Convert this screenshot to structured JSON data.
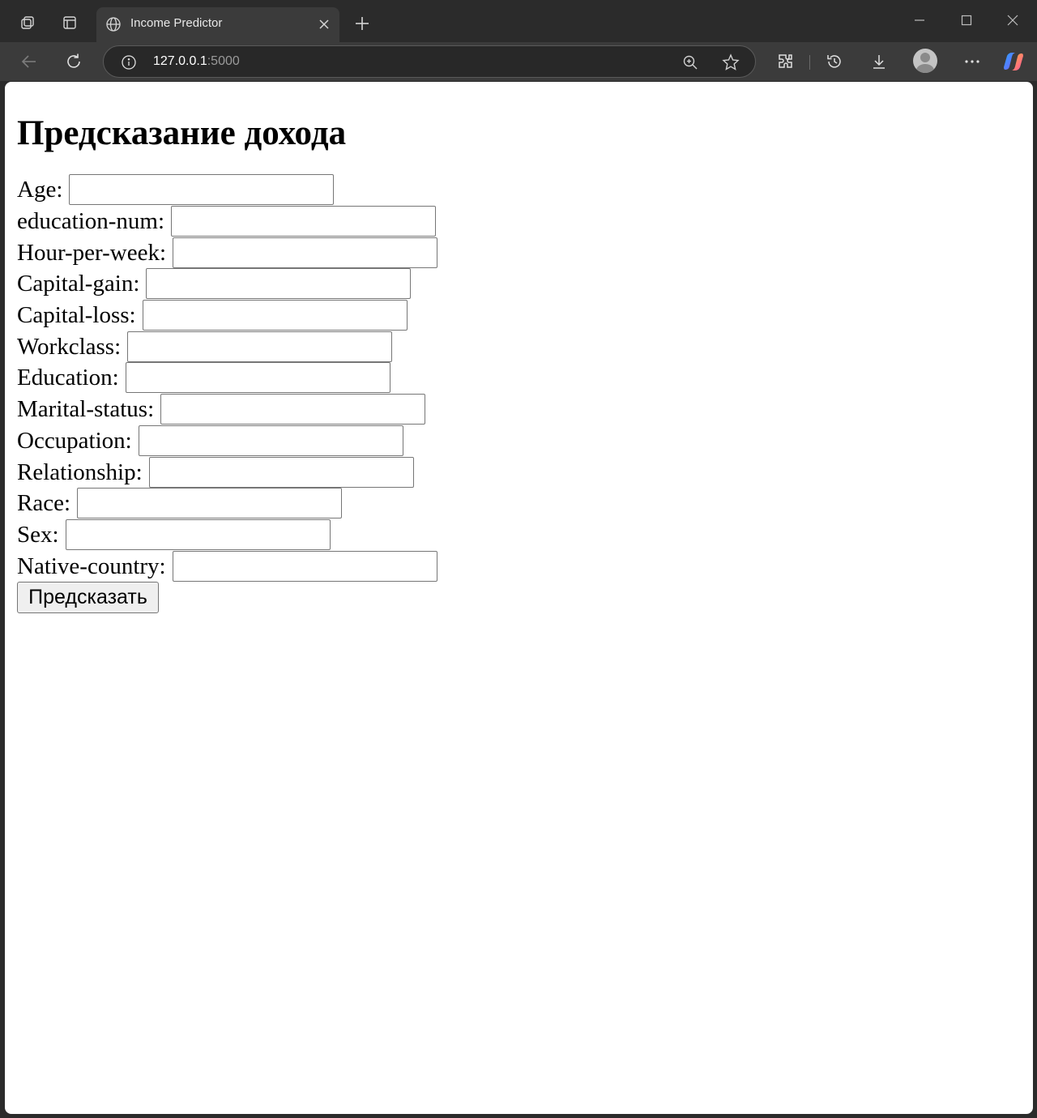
{
  "browser": {
    "tab_title": "Income Predictor",
    "url_host": "127.0.0.1",
    "url_port": ":5000"
  },
  "page": {
    "heading": "Предсказание дохода",
    "fields": [
      {
        "label": "Age:",
        "value": ""
      },
      {
        "label": "education-num:",
        "value": ""
      },
      {
        "label": "Hour-per-week:",
        "value": ""
      },
      {
        "label": "Capital-gain:",
        "value": ""
      },
      {
        "label": "Capital-loss:",
        "value": ""
      },
      {
        "label": "Workclass:",
        "value": ""
      },
      {
        "label": "Education:",
        "value": ""
      },
      {
        "label": "Marital-status:",
        "value": ""
      },
      {
        "label": "Occupation:",
        "value": ""
      },
      {
        "label": "Relationship:",
        "value": ""
      },
      {
        "label": "Race:",
        "value": ""
      },
      {
        "label": "Sex:",
        "value": ""
      },
      {
        "label": "Native-country:",
        "value": ""
      }
    ],
    "submit_label": "Предсказать"
  }
}
